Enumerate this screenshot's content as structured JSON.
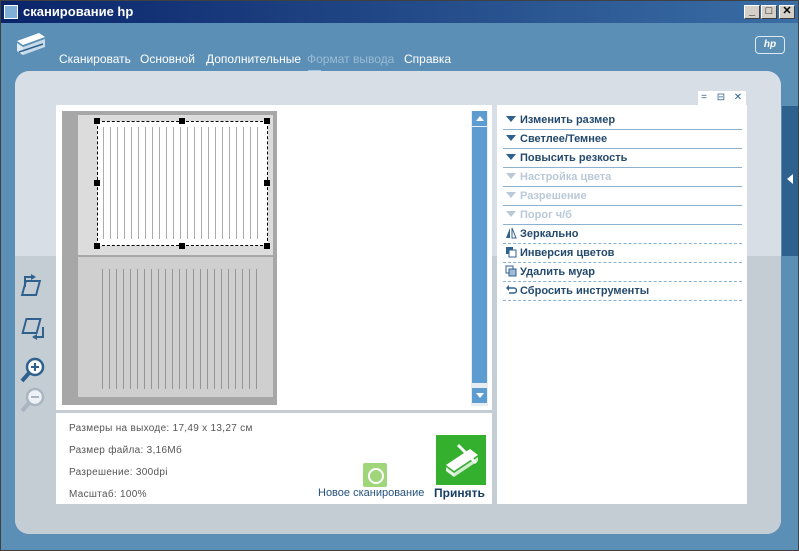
{
  "window": {
    "title": "сканирование hp"
  },
  "window_buttons": {
    "minimize": "_",
    "maximize": "□",
    "close": "✕"
  },
  "nav": {
    "items": [
      {
        "label": "Сканировать",
        "state": "normal"
      },
      {
        "label": "Основной",
        "state": "normal"
      },
      {
        "label": "Дополнительные",
        "state": "normal"
      },
      {
        "label": "Формат вывода",
        "state": "disabled"
      },
      {
        "label": "Справка",
        "state": "normal"
      }
    ]
  },
  "brand": {
    "logo_text": "hp"
  },
  "info": {
    "output_size": "Размеры на выходе: 17,49 x 13,27 см",
    "file_size": "Размер файла: 3,16Мб",
    "resolution": "Разрешение:  300dpi",
    "scale": "Масштаб: 100%"
  },
  "actions": {
    "new_scan": "Новое сканирование",
    "accept": "Принять"
  },
  "tools_panel": {
    "controls": [
      "=",
      "⊟",
      "✕"
    ],
    "items": [
      {
        "label": "Изменить размер",
        "type": "expand",
        "enabled": true
      },
      {
        "label": "Светлее/Темнее",
        "type": "expand",
        "enabled": true
      },
      {
        "label": "Повысить резкость",
        "type": "expand",
        "enabled": true
      },
      {
        "label": "Настройка цвета",
        "type": "expand",
        "enabled": false
      },
      {
        "label": "Разрешение",
        "type": "expand",
        "enabled": false
      },
      {
        "label": "Порог ч/б",
        "type": "expand",
        "enabled": false
      },
      {
        "label": "Зеркально",
        "type": "mirror",
        "enabled": true
      },
      {
        "label": "Инверсия цветов",
        "type": "invert",
        "enabled": true
      },
      {
        "label": "Удалить муар",
        "type": "moire",
        "enabled": true
      },
      {
        "label": "Сбросить инструменты",
        "type": "reset",
        "enabled": true
      }
    ]
  },
  "colors": {
    "accent": "#5b8fb6",
    "panel": "#d7dee5",
    "accept_green": "#34b02e",
    "text_blue": "#244a6d"
  }
}
